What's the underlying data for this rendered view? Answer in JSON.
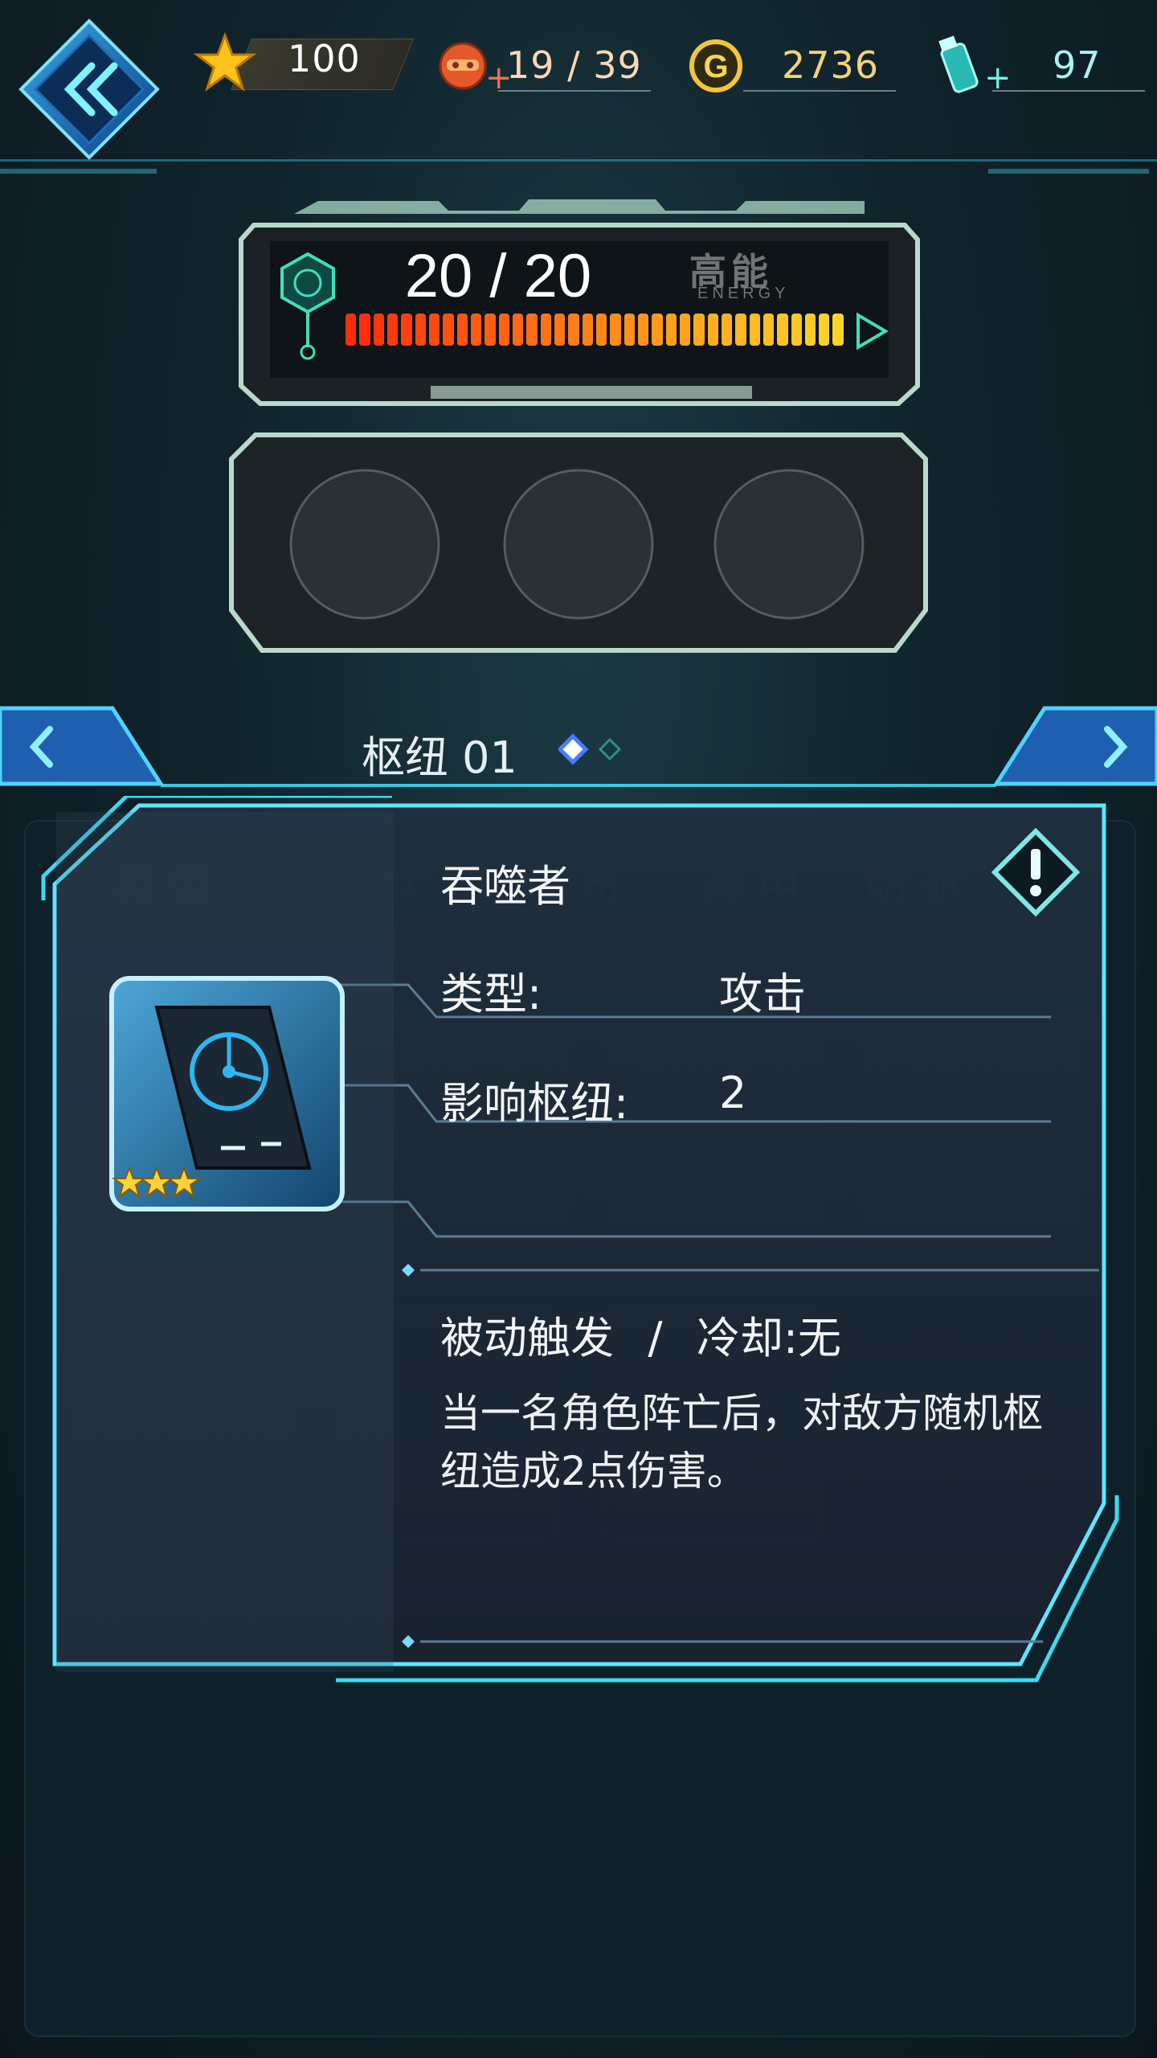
{
  "hud": {
    "stars": "100",
    "energy": "19 / 39",
    "gold": "2736",
    "potion": "97"
  },
  "energy_panel": {
    "value_text": "20 / 20",
    "current": 20,
    "max": 20,
    "label": "高能",
    "label_sub": "ENERGY"
  },
  "hub": {
    "name": "枢纽 01",
    "page_count": 2,
    "active_page": 1
  },
  "background_tabs": [
    "类型",
    "全部",
    "攻击",
    "通用",
    "防御"
  ],
  "item": {
    "name": "吞噬者",
    "type_label": "类型:",
    "type_value": "攻击",
    "affect_label": "影响枢纽:",
    "affect_value": "2",
    "rarity_stars": 3,
    "trigger": "被动触发  /  冷却:无",
    "description": "当一名角色阵亡后，对敌方随机枢纽造成2点伤害。"
  },
  "colors": {
    "accent": "#3fd8f2",
    "gold": "#f3d27a",
    "energy_start": "#ff3b12",
    "energy_end": "#ffd21e"
  }
}
